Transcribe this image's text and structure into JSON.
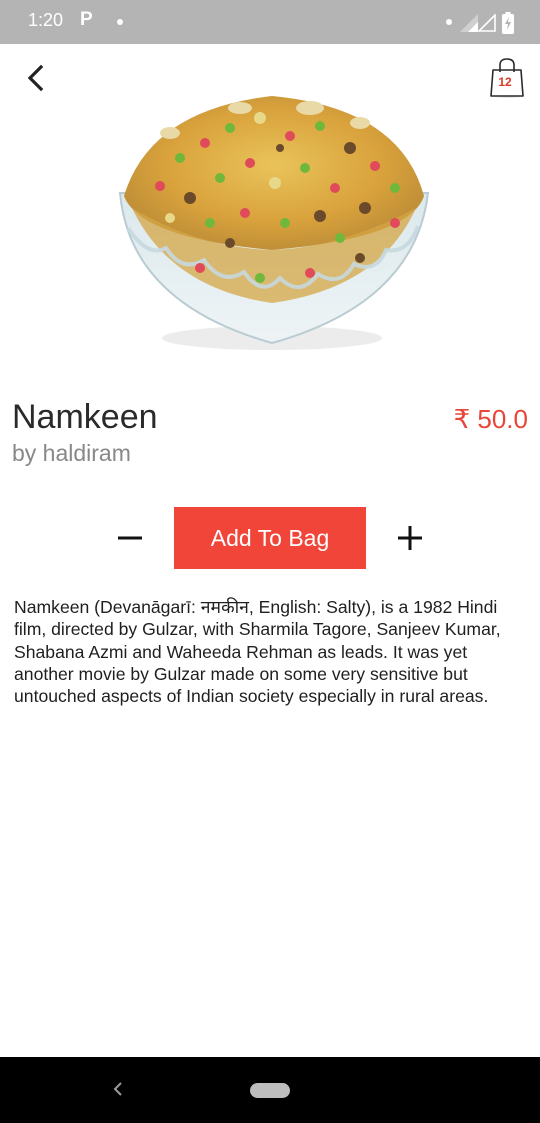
{
  "status_bar": {
    "time": "1:20",
    "notification_icon": "parking-p-icon",
    "icons": [
      "dot-icon",
      "signal-x-icon",
      "signal-icon",
      "battery-charging-icon"
    ]
  },
  "header": {
    "back_icon": "chevron-left-icon",
    "bag_icon": "shopping-bag-icon",
    "bag_count": "12"
  },
  "product": {
    "image_icon": "namkeen-bowl-image",
    "name": "Namkeen",
    "brand": "by haldiram",
    "price": "₹ 50.0",
    "description": "Namkeen (Devanāgarī: नमकीन, English: Salty), is a 1982 Hindi film, directed by Gulzar, with Sharmila Tagore, Sanjeev Kumar, Shabana Azmi and Waheeda Rehman as leads. It was yet another movie by Gulzar made on some very sensitive but untouched aspects of Indian society especially in rural areas."
  },
  "actions": {
    "minus_icon": "minus-icon",
    "add_to_bag_label": "Add To Bag",
    "plus_icon": "plus-icon"
  },
  "nav_bar": {
    "back_icon": "nav-back-icon",
    "home_icon": "nav-home-pill-icon"
  },
  "colors": {
    "accent": "#f2453a",
    "price": "#e8463a",
    "status_bar": "#b4b4b4",
    "nav_bar": "#000000"
  }
}
